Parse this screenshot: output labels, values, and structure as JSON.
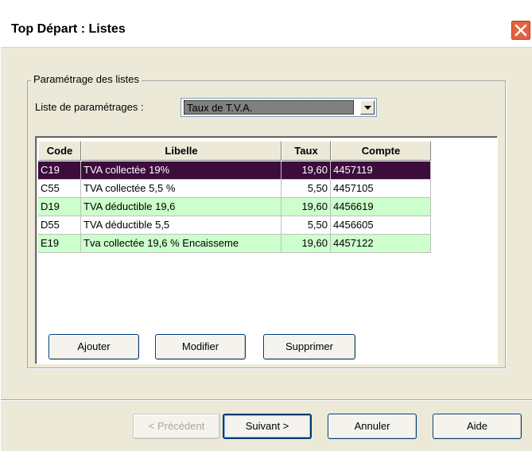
{
  "window": {
    "title": "Top Départ : Listes"
  },
  "group": {
    "legend": "Paramétrage des listes"
  },
  "combo": {
    "label": "Liste de paramétrages :",
    "value": "Taux de T.V.A."
  },
  "table": {
    "columns": [
      "Code",
      "Libelle",
      "Taux",
      "Compte"
    ],
    "rows": [
      {
        "code": "C19",
        "libelle": "TVA collectée 19%",
        "taux": "19,60",
        "compte": "4457119",
        "bg": "#3c0c3c",
        "selected": true
      },
      {
        "code": "C55",
        "libelle": "TVA collectée 5,5 %",
        "taux": "5,50",
        "compte": "4457105",
        "bg": "#ffffff",
        "selected": false
      },
      {
        "code": "D19",
        "libelle": "TVA déductible 19,6",
        "taux": "19,60",
        "compte": "4456619",
        "bg": "#ccffcc",
        "selected": false
      },
      {
        "code": "D55",
        "libelle": "TVA déductible 5,5",
        "taux": "5,50",
        "compte": "4456605",
        "bg": "#ffffff",
        "selected": false
      },
      {
        "code": "E19",
        "libelle": "Tva collectée 19,6 % Encaisseme",
        "taux": "19,60",
        "compte": "4457122",
        "bg": "#ccffcc",
        "selected": false
      }
    ]
  },
  "list_buttons": {
    "add": "Ajouter",
    "edit": "Modifier",
    "delete": "Supprimer"
  },
  "wizard_buttons": {
    "previous": "< Précédent",
    "next": "Suivant >",
    "cancel": "Annuler",
    "help": "Aide"
  },
  "icons": {
    "close": "close-icon",
    "dropdown": "chevron-down-icon"
  }
}
